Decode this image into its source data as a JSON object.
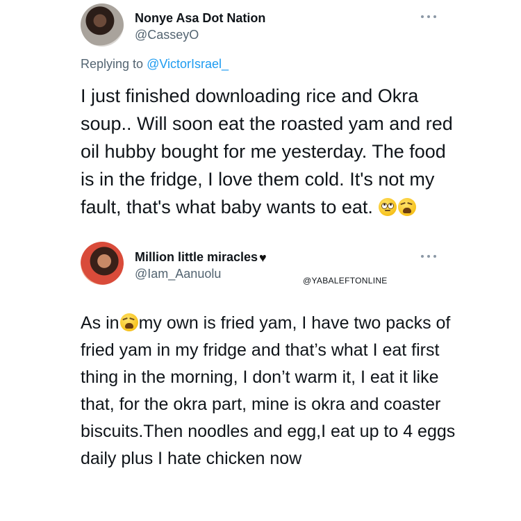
{
  "tweet1": {
    "display_name": "Nonye Asa Dot Nation",
    "handle": "@CasseyO",
    "replying_prefix": "Replying to ",
    "replying_handle": "@VictorIsrael_",
    "text": "I just finished downloading rice and Okra soup.. Will soon eat the roasted yam and red oil hubby bought for me yesterday. The food is in the fridge, I love them cold. It's not my fault, that's what baby wants to eat.",
    "emojis": [
      "rolling-eyes-emoji",
      "weary-face-emoji"
    ]
  },
  "tweet2": {
    "display_name": "Million little miracles",
    "badge_emoji": "black-heart-emoji",
    "handle": "@Iam_Aanuolu",
    "text_before_emoji": "As in",
    "emoji": "weary-face-emoji",
    "text_after_emoji": "my own is fried yam, I have two packs of fried yam in my fridge and that’s what I eat first thing in the morning, I don’t warm it, I eat it like that, for the okra part, mine is okra and coaster biscuits.Then noodles and egg,I eat up to 4 eggs daily plus I hate chicken now"
  },
  "watermark": "@YABALEFTONLINE",
  "colors": {
    "text": "#0f1419",
    "secondary": "#536471",
    "link": "#1d9bf0"
  }
}
